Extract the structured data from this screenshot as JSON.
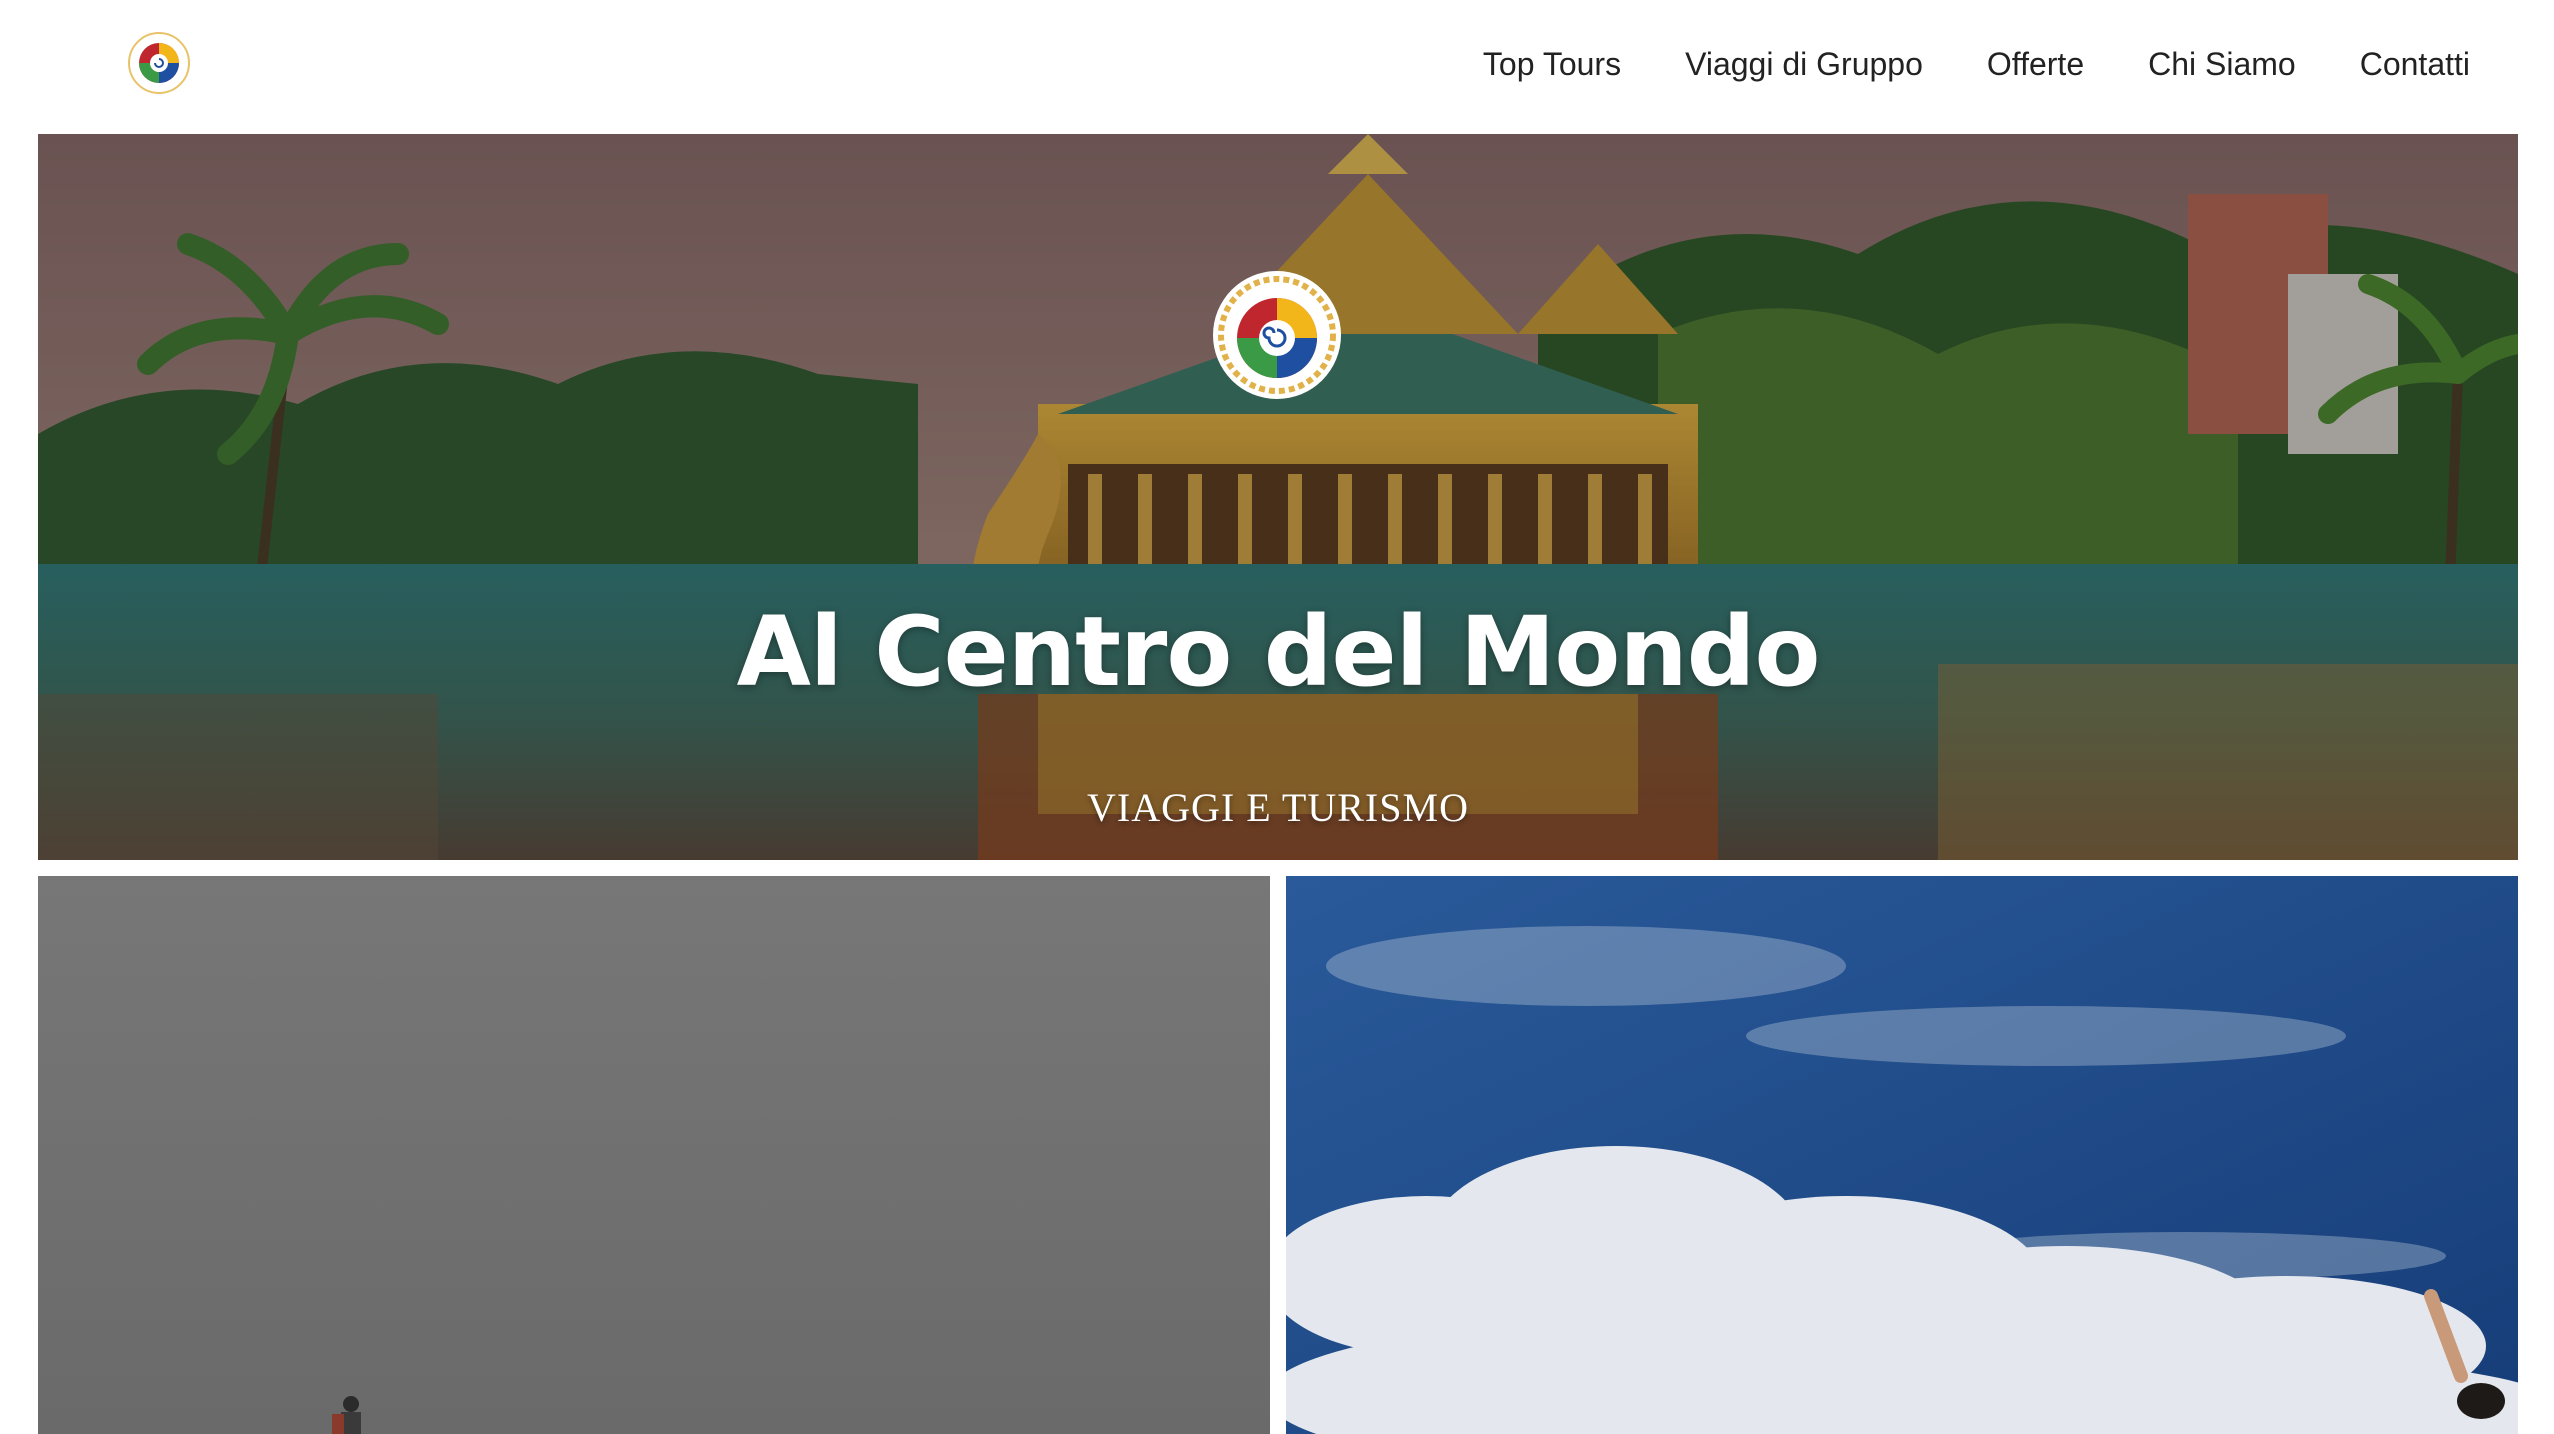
{
  "header": {
    "logo_alt": "Al Centro del Mondo logo",
    "nav": [
      {
        "label": "Top Tours"
      },
      {
        "label": "Viaggi di Gruppo"
      },
      {
        "label": "Offerte"
      },
      {
        "label": "Chi Siamo"
      },
      {
        "label": "Contatti"
      }
    ]
  },
  "hero": {
    "title": "Al Centro del Mondo",
    "subtitle": "VIAGGI E TURISMO",
    "background_image": "lake-temple-scene",
    "badge_icon": "spiral-logo-icon"
  },
  "cards": [
    {
      "image": "misty-hiker-photo"
    },
    {
      "image": "blue-sky-clouds-photo"
    }
  ],
  "colors": {
    "nav_text": "#222222",
    "hero_text": "#ffffff",
    "logo_red": "#c0262d",
    "logo_blue": "#1f4fa0",
    "logo_yellow": "#f2b61a",
    "logo_green": "#3a9a45"
  }
}
